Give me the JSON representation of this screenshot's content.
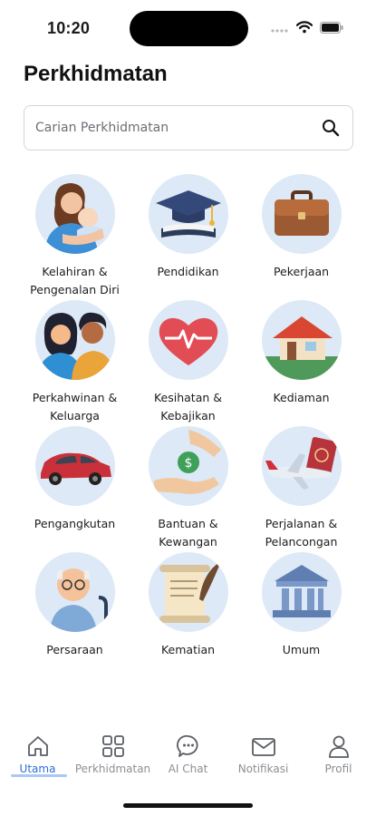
{
  "status": {
    "time": "10:20",
    "icons": [
      "signal-dots-icon",
      "wifi-icon",
      "battery-icon"
    ]
  },
  "header": {
    "title": "Perkhidmatan"
  },
  "search": {
    "placeholder": "Carian Perkhidmatan",
    "value": "",
    "icon": "search-icon"
  },
  "services": [
    {
      "label": "Kelahiran & Pengenalan Diri",
      "icon": "mother-baby-icon"
    },
    {
      "label": "Pendidikan",
      "icon": "graduation-cap-icon"
    },
    {
      "label": "Pekerjaan",
      "icon": "briefcase-icon"
    },
    {
      "label": "Perkahwinan & Keluarga",
      "icon": "couple-icon"
    },
    {
      "label": "Kesihatan & Kebajikan",
      "icon": "heartbeat-icon"
    },
    {
      "label": "Kediaman",
      "icon": "house-icon"
    },
    {
      "label": "Pengangkutan",
      "icon": "car-icon"
    },
    {
      "label": "Bantuan & Kewangan",
      "icon": "money-hand-icon"
    },
    {
      "label": "Perjalanan & Pelancongan",
      "icon": "airplane-passport-icon"
    },
    {
      "label": "Persaraan",
      "icon": "elderly-man-icon"
    },
    {
      "label": "Kematian",
      "icon": "scroll-quill-icon"
    },
    {
      "label": "Umum",
      "icon": "government-building-icon"
    }
  ],
  "nav": {
    "active": "Utama",
    "accent": "#2f6fd6",
    "items": [
      {
        "label": "Utama",
        "icon": "home-icon"
      },
      {
        "label": "Perkhidmatan",
        "icon": "grid-icon"
      },
      {
        "label": "AI Chat",
        "icon": "chat-bubble-icon"
      },
      {
        "label": "Notifikasi",
        "icon": "envelope-icon"
      },
      {
        "label": "Profil",
        "icon": "user-icon"
      }
    ]
  }
}
